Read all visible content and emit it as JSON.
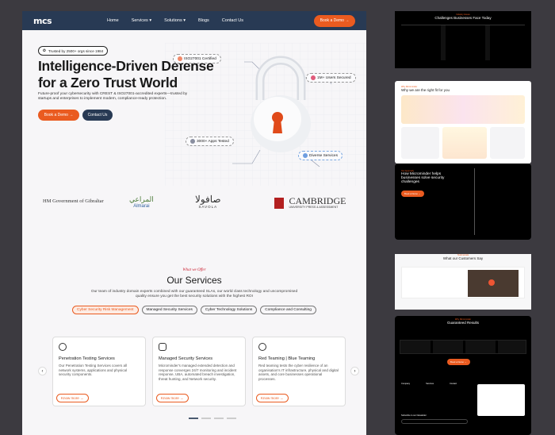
{
  "nav": {
    "logo": "mcs",
    "links": [
      "Home",
      "Services",
      "Solutions",
      "Blogs",
      "Contact Us"
    ],
    "demo": "Book a Demo →"
  },
  "hero": {
    "trusted": "Trusted by 2500+ orgs since 1984",
    "title": "Intelligence-Driven Defense for a Zero Trust World",
    "subtitle": "Future-proof your cybersecurity with CREST & ISO27001-accredited experts—trusted by startups and enterprises to implement modern, compliance-ready protection.",
    "demo": "Book a Demo →",
    "contact": "Contact Us",
    "pills": [
      "ISO27001 Certified",
      "1M+ Users Secured",
      "3000+ Apps Tested",
      "Diverse Services"
    ]
  },
  "logos": [
    "HM Government of Gibraltar",
    "المراعي",
    "Almarai",
    "صافولا",
    "SAVOLA",
    "CAMBRIDGE",
    "UNIVERSITY PRESS & ASSESSMENT"
  ],
  "services": {
    "eyebrow": "What we Offer",
    "title": "Our Services",
    "desc": "Our team of industry domain experts combined with our guaranteed SLAs, our world class technology and uncompromised quality ensure you get the best security solutions with the highest ROI",
    "tabs": [
      "Cyber Security Risk Management",
      "Managed Security Services",
      "Cyber Technology Solutions",
      "Compliance and Consulting"
    ],
    "cards": [
      {
        "title": "Penetration Testing Services",
        "desc": "Our Penetration Testing Services covers all network systems, applications and physical security components.",
        "more": "Know more →"
      },
      {
        "title": "Managed Security Services",
        "desc": "Microminder's managed extended detection and response converges 24/7 monitoring and incident response, UBA, automated breach investigation, threat hunting, and Network security.",
        "more": "Know more →"
      },
      {
        "title": "Red Teaming | Blue Teaming",
        "desc": "Red teaming tests the cyber resilience of an organisation's IT infrastructure, physical and digital assets, and core businesses operational processes.",
        "more": "Know more →"
      }
    ]
  },
  "right": {
    "p1": {
      "eyebrow": "Industry Issues",
      "title": "Challenges Businesses Face Today"
    },
    "p2": {
      "eyebrow": "Why Microminder",
      "title": "Why we are the right fit for you"
    },
    "p3": {
      "eyebrow": "Our Approach",
      "title": "How Microminder helps businesses solve security challenges",
      "cta": "Book a Demo →"
    },
    "p4": {
      "eyebrow": "Testimonials",
      "title": "What our Customers Say"
    },
    "p5": {
      "eyebrow": "Why Microminder",
      "title": "Guaranteed Results",
      "cta": "Book a Demo →"
    },
    "p6": {
      "cols": [
        "Company",
        "Services",
        "Contact"
      ],
      "newsletter": "Subscribe to our Newsletter"
    }
  }
}
